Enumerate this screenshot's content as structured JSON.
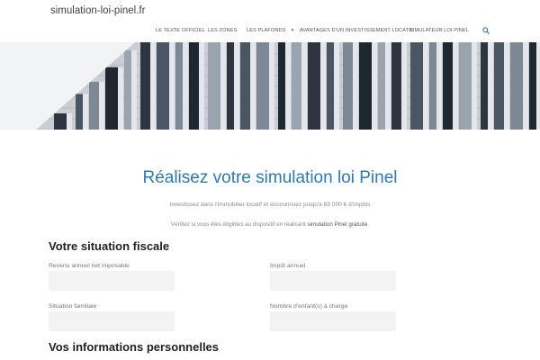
{
  "header": {
    "site_title": "simulation-loi-pinel.fr",
    "nav": [
      {
        "label": "LE TEXTE OFFICIEL"
      },
      {
        "label": "LES ZONES"
      },
      {
        "label": "LES PLAFONDS",
        "has_dropdown": true
      },
      {
        "label": "AVANTAGES D'UN INVESTISSEMENT LOCATIF"
      },
      {
        "label": "SIMULATEUR LOI PINEL"
      }
    ],
    "search_icon": "search-icon"
  },
  "hero": {
    "image": "building-facade"
  },
  "main": {
    "heading": "Réalisez votre simulation loi Pinel",
    "tagline": "Investissez dans l'immobilier locatif et économisez jusqu'à 63 000 € d'impôts",
    "intro_prefix": "Vérifiez si vous êtes éligibles au dispositif en réalisant",
    "intro_strong": "simulation Pinel gratuite",
    "intro_suffix": "."
  },
  "form": {
    "section1_title": "Votre situation fiscale",
    "fields": [
      {
        "label": "Revenu annuel net imposable",
        "value": ""
      },
      {
        "label": "Impôt annuel",
        "value": ""
      },
      {
        "label": "Situation familiale",
        "value": ""
      },
      {
        "label": "Nombre d'enfant(s) à charge",
        "value": ""
      }
    ],
    "section2_title": "Vos informations personnelles"
  },
  "colors": {
    "accent": "#2b7ab5",
    "field_bg": "#f3f3f3"
  }
}
